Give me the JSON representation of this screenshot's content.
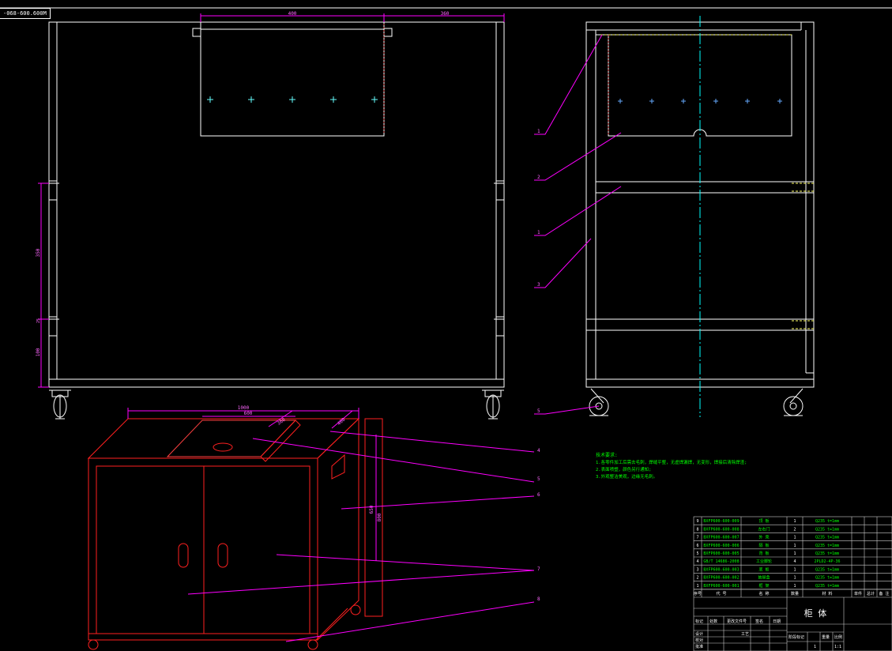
{
  "file_tab": "-068-600.600M",
  "front_view": {
    "dims": {
      "top_width": "400",
      "top_right": "360",
      "mid_height": "350",
      "low_height": "25",
      "bottom_height": "100"
    }
  },
  "side_view": {
    "callouts": [
      "1",
      "2",
      "1",
      "3",
      "5"
    ]
  },
  "iso_view": {
    "dims": {
      "top_outer": "1000",
      "top_inner": "600",
      "angle_a": "360",
      "angle_b": "400",
      "height_a": "650",
      "height_b": "800"
    },
    "callouts": [
      "4",
      "5",
      "6",
      "7",
      "8"
    ]
  },
  "notes": {
    "title": "技术要求:",
    "lines": [
      "1.各零件加工后需去毛刺，焊缝平整，无虚焊漏焊，无变形，焊接后清除焊渣;",
      "2.表面喷塑，颜色另行通知;",
      "3.外观整洁美观，边缘无毛刺。"
    ]
  },
  "bom": {
    "rows": [
      {
        "no": "9",
        "code": "BXFP600-600-009",
        "name": "顶 板",
        "qty": "1",
        "material": "Q235 t=1mm"
      },
      {
        "no": "8",
        "code": "BXFP600-600-008",
        "name": "左右门",
        "qty": "2",
        "material": "Q235 t=1mm"
      },
      {
        "no": "7",
        "code": "BXFP600-600-007",
        "name": "外 壳",
        "qty": "1",
        "material": "Q235 t=1mm"
      },
      {
        "no": "6",
        "code": "BXFP600-600-006",
        "name": "隔 板",
        "qty": "1",
        "material": "Q235 t=1mm"
      },
      {
        "no": "5",
        "code": "BXFP600-600-005",
        "name": "背 板",
        "qty": "1",
        "material": "Q235 t=1mm"
      },
      {
        "no": "4",
        "code": "GB/T 14686-2008",
        "name": "工业脚轮",
        "qty": "4",
        "material": "2PLD2-4P-36"
      },
      {
        "no": "3",
        "code": "BXFP600-600-003",
        "name": "底 板",
        "qty": "1",
        "material": "Q235 t=1mm"
      },
      {
        "no": "2",
        "code": "BXFP600-600-002",
        "name": "抽屉盒",
        "qty": "1",
        "material": "Q235 t=1mm"
      },
      {
        "no": "1",
        "code": "BXFP600-600-001",
        "name": "框 架",
        "qty": "1",
        "material": "Q235 t=1mm"
      }
    ],
    "header": [
      "序号",
      "代 号",
      "名 称",
      "数量",
      "材 料",
      "单件",
      "总计",
      "备 注"
    ],
    "title": "柜 体",
    "labels": {
      "mark": "标记",
      "count": "处数",
      "doc": "更改文件号",
      "sign": "签名",
      "date": "日期",
      "design": "设计",
      "check": "校对",
      "process": "工艺",
      "approve": "批准",
      "stage": "阶段标记",
      "weight": "重量",
      "scale": "比例",
      "sheet_num": "1",
      "scale_val": "1:1"
    }
  },
  "colors": {
    "background": "#000000",
    "outline": "#ffffff",
    "callout": "#ff00ff",
    "centerline": "#00ffff",
    "iso": "#ff0000",
    "dimension": "#ff00ff",
    "note": "#00ff00",
    "hidden": "#ffff66"
  }
}
